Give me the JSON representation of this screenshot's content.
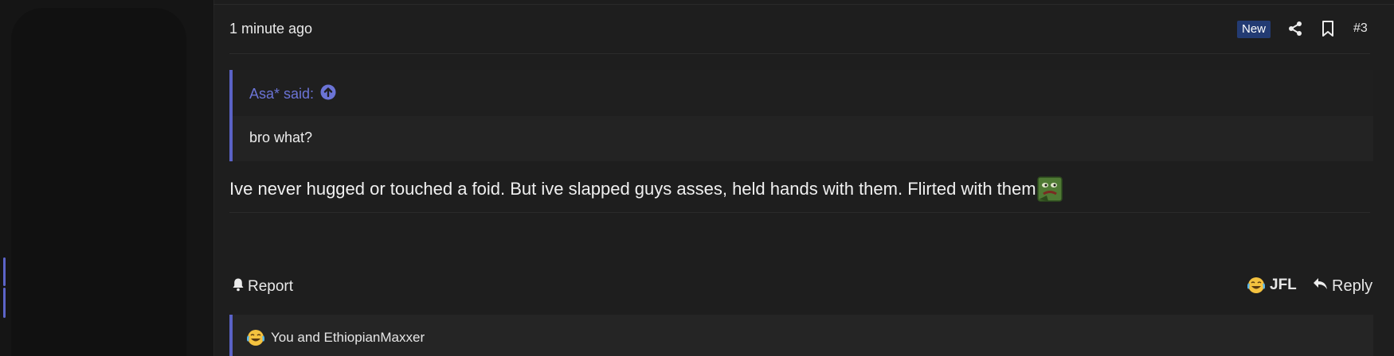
{
  "post": {
    "time": "1 minute ago",
    "badge": "New",
    "number": "#3",
    "share_icon": "share-icon",
    "bookmark_icon": "bookmark-icon"
  },
  "quote": {
    "author": "Asa* said:",
    "expand_icon": "arrow-up-circle-icon",
    "body": "bro what?"
  },
  "message": {
    "text": "Ive never hugged or touched a foid. But ive slapped guys asses, held hands with them. Flirted with them",
    "emoji": "pepe-emoji"
  },
  "actions": {
    "report": "Report",
    "reaction": "JFL",
    "reply": "Reply"
  },
  "reactions": {
    "summary": "You and EthiopianMaxxer"
  },
  "colors": {
    "accent": "#5a62c6",
    "badge_bg": "#233b73",
    "background": "#1d1d1d"
  }
}
